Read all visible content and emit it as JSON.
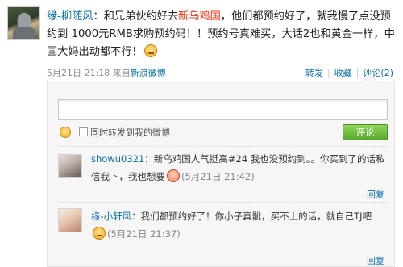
{
  "post": {
    "author": "缘-柳随风",
    "text_part1": "：和兄弟伙约好去",
    "highlight": "新乌鸡国",
    "text_part2": "，他们都预约好了，就我慢了点没预约到 1000元RMB求购预约码！！预约号真难买，大话2也和黄金一样，中国大妈出动都不行！",
    "time": "5月21日 21:18",
    "from_prefix": "来自",
    "from_source": "新浪微博",
    "actions": [
      "转发",
      "收藏",
      "评论(2)"
    ]
  },
  "reply_box": {
    "input_placeholder": "",
    "checkbox_label": "同时转发到我的微博",
    "submit_label": "评论"
  },
  "comments": [
    {
      "author": "showu0321",
      "text": "：新乌鸡国人气挺高#24 我也没预约到。。你买到了的话私信我下，我也想要",
      "time": "(5月21日 21:42)",
      "reply": "回复"
    },
    {
      "author": "缘-小轩风",
      "text": "：我们都预约好了！你小子真骴，买不上的话，就自己TJ吧",
      "time": "(5月21日 21:37)",
      "reply": "回复"
    }
  ],
  "colors": {
    "link": "#0a6fa8",
    "highlight": "#e8330f",
    "submit_green": "#5aa82e"
  }
}
